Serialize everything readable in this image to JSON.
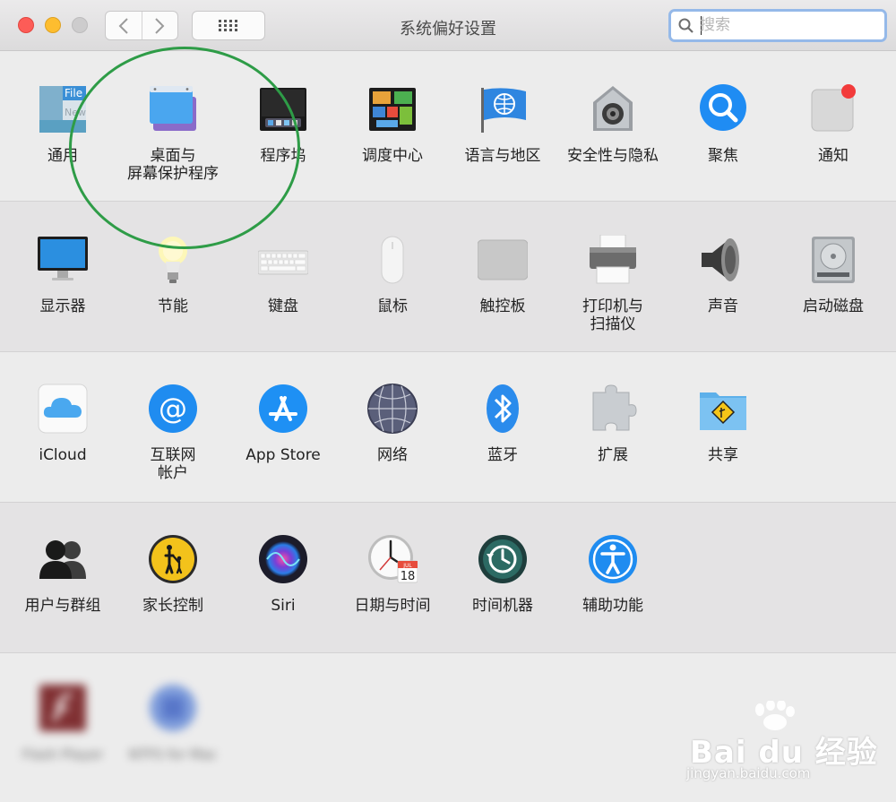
{
  "window": {
    "title": "系统偏好设置"
  },
  "search": {
    "placeholder": "搜索",
    "value": ""
  },
  "rows": [
    [
      {
        "name": "pref-general",
        "label": "通用",
        "icon": "general-icon"
      },
      {
        "name": "pref-desktop-screensaver",
        "label": "桌面与\n屏幕保护程序",
        "icon": "desktop-screensaver-icon"
      },
      {
        "name": "pref-dock",
        "label": "程序坞",
        "icon": "dock-icon"
      },
      {
        "name": "pref-mission-control",
        "label": "调度中心",
        "icon": "mission-control-icon"
      },
      {
        "name": "pref-language-region",
        "label": "语言与地区",
        "icon": "language-region-icon"
      },
      {
        "name": "pref-security-privacy",
        "label": "安全性与隐私",
        "icon": "security-privacy-icon"
      },
      {
        "name": "pref-spotlight",
        "label": "聚焦",
        "icon": "spotlight-icon"
      },
      {
        "name": "pref-notifications",
        "label": "通知",
        "icon": "notifications-icon"
      }
    ],
    [
      {
        "name": "pref-displays",
        "label": "显示器",
        "icon": "displays-icon"
      },
      {
        "name": "pref-energy-saver",
        "label": "节能",
        "icon": "energy-saver-icon"
      },
      {
        "name": "pref-keyboard",
        "label": "键盘",
        "icon": "keyboard-icon"
      },
      {
        "name": "pref-mouse",
        "label": "鼠标",
        "icon": "mouse-icon"
      },
      {
        "name": "pref-trackpad",
        "label": "触控板",
        "icon": "trackpad-icon"
      },
      {
        "name": "pref-printers-scanners",
        "label": "打印机与\n扫描仪",
        "icon": "printer-icon"
      },
      {
        "name": "pref-sound",
        "label": "声音",
        "icon": "sound-icon"
      },
      {
        "name": "pref-startup-disk",
        "label": "启动磁盘",
        "icon": "startup-disk-icon"
      }
    ],
    [
      {
        "name": "pref-icloud",
        "label": "iCloud",
        "icon": "icloud-icon"
      },
      {
        "name": "pref-internet-accounts",
        "label": "互联网\n帐户",
        "icon": "internet-accounts-icon"
      },
      {
        "name": "pref-app-store",
        "label": "App Store",
        "icon": "app-store-icon"
      },
      {
        "name": "pref-network",
        "label": "网络",
        "icon": "network-icon"
      },
      {
        "name": "pref-bluetooth",
        "label": "蓝牙",
        "icon": "bluetooth-icon"
      },
      {
        "name": "pref-extensions",
        "label": "扩展",
        "icon": "extensions-icon"
      },
      {
        "name": "pref-sharing",
        "label": "共享",
        "icon": "sharing-icon"
      }
    ],
    [
      {
        "name": "pref-users-groups",
        "label": "用户与群组",
        "icon": "users-groups-icon"
      },
      {
        "name": "pref-parental-controls",
        "label": "家长控制",
        "icon": "parental-controls-icon"
      },
      {
        "name": "pref-siri",
        "label": "Siri",
        "icon": "siri-icon"
      },
      {
        "name": "pref-date-time",
        "label": "日期与时间",
        "icon": "date-time-icon"
      },
      {
        "name": "pref-time-machine",
        "label": "时间机器",
        "icon": "time-machine-icon"
      },
      {
        "name": "pref-accessibility",
        "label": "辅助功能",
        "icon": "accessibility-icon"
      }
    ],
    [
      {
        "name": "pref-flash-player",
        "label": "Flash Player",
        "icon": "flash-player-icon"
      },
      {
        "name": "pref-ntfs-for-mac",
        "label": "NTFS for Mac",
        "icon": "ntfs-icon"
      }
    ]
  ],
  "icon_text": {
    "general_file": "File",
    "general_new": "New",
    "calendar_month": "JUL",
    "calendar_day": "18"
  },
  "watermark": {
    "logo": "Bai du 经验",
    "url": "jingyan.baidu.com"
  },
  "colors": {
    "accent": "#2f7ee8",
    "highlight_circle": "#2e9c47",
    "search_focus": "#95b9e9"
  }
}
